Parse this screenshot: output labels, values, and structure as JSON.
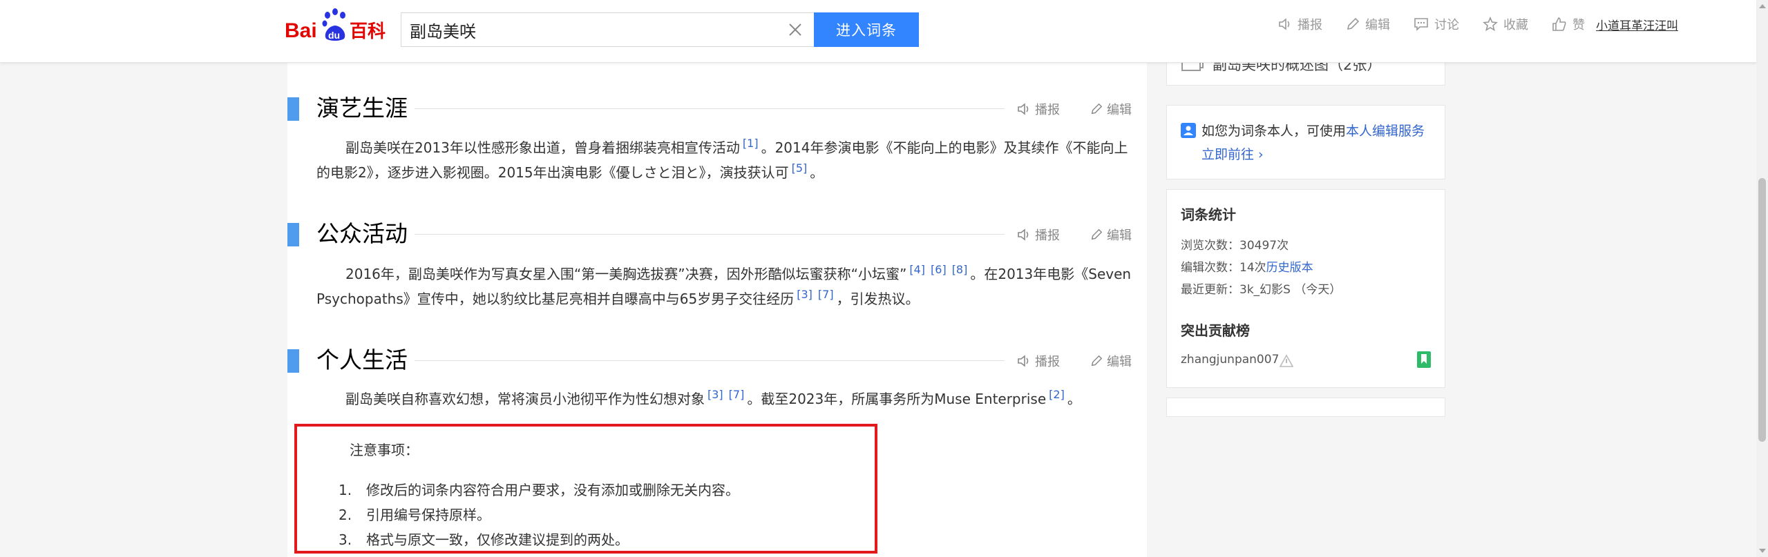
{
  "header": {
    "logo_text": "Bai du 百科",
    "search_value": "副岛美咲",
    "enter_button": "进入词条",
    "actions": [
      "播报",
      "编辑",
      "讨论",
      "收藏",
      "赞"
    ],
    "user": "小道耳革汪汪叫"
  },
  "sections": [
    {
      "title": "演艺生涯",
      "tools": [
        "播报",
        "编辑"
      ],
      "line1_a": "副岛美咲在2013年以性感形象出道，曾身着捆绑装亮相宣传活动",
      "line1_ref": "[1]",
      "line1_b": "。2014年参演电影《不能向上的电影》及其续作《不能",
      "line2_a": "向上的电影2》，逐步进入影视圈。2015年出演电影《優しさと泪と》，演技获认可",
      "line2_ref": "[5]",
      "line2_b": "。"
    },
    {
      "title": "公众活动",
      "tools": [
        "播报",
        "编辑"
      ],
      "line1_a": "2016年，副岛美咲作为写真女星入围“第一美胸选拔赛”决赛，因外形酷似坛蜜获称“小坛蜜”",
      "line1_refs": [
        "[4]",
        "[6]",
        "[8]"
      ],
      "line1_b": "。在2013年电影",
      "line2_a": "《Seven Psychopaths》宣传中，她以豹纹比基尼亮相并自曝高中与65岁男子交往经历",
      "line2_refs": [
        "[3]",
        "[7]"
      ],
      "line2_b": "，引发热议。"
    },
    {
      "title": "个人生活",
      "tools": [
        "播报",
        "编辑"
      ],
      "line1_a": "副岛美咲自称喜欢幻想，常将演员小池彻平作为性幻想对象",
      "line1_refs": [
        "[3]",
        "[7]"
      ],
      "line1_b": "。截至2023年，所属事务所为Muse Enterprise",
      "line1_ref2": "[2]",
      "line1_c": "。"
    }
  ],
  "note": {
    "title": "注意事项：",
    "items": [
      {
        "num": "1.",
        "text": "修改后的词条内容符合用户要求，没有添加或删除无关内容。"
      },
      {
        "num": "2.",
        "text": "引用编号保持原样。"
      },
      {
        "num": "3.",
        "text": "格式与原文一致，仅修改建议提到的两处。"
      }
    ]
  },
  "sidebar": {
    "overview_label": "副岛美咲的概述图（2张）",
    "claim_text": "如您为词条本人，可使用",
    "claim_link": "本人编辑服务",
    "claim_go": "立即前往 ›",
    "stats_title": "词条统计",
    "views_label": "浏览次数：",
    "views_value": "30497次",
    "edits_label": "编辑次数：",
    "edits_value": "14次",
    "history_link": "历史版本",
    "updated_label": "最近更新：",
    "updated_value": "3k_幻影S （今天）",
    "contrib_title": "突出贡献榜",
    "contributor": "zhangjunpan007"
  },
  "colors": {
    "accent": "#3385ff",
    "section_bar": "#4f9cee",
    "note_border": "#e31a1c",
    "link": "#3366cc",
    "badge_green": "#2dbb6a"
  }
}
